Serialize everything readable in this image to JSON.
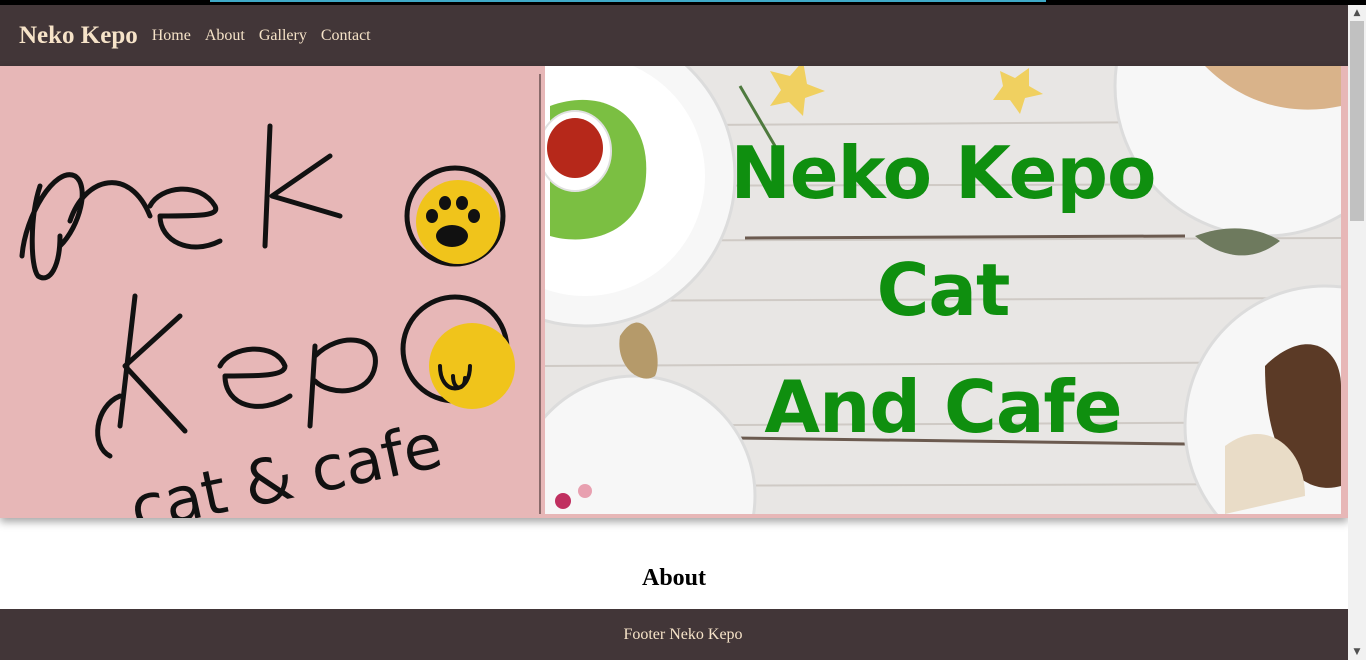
{
  "navbar": {
    "brand": "Neko Kepo",
    "links": [
      "Home",
      "About",
      "Gallery",
      "Contact"
    ]
  },
  "hero": {
    "logo_lines": [
      "neko",
      "kepo",
      "cat & cafe"
    ],
    "banner_lines": [
      "Neko Kepo",
      "Cat",
      "And Cafe"
    ]
  },
  "main": {
    "about_title": "About"
  },
  "footer": {
    "text": "Footer Neko Kepo"
  },
  "colors": {
    "nav_bg": "#423638",
    "nav_text": "#f6e3c8",
    "hero_bg": "#e7b7b7",
    "banner_text": "#0f8f0f",
    "paw_yellow": "#f0c41b"
  },
  "icons": {
    "paw": "paw-icon",
    "scroll_up": "chevron-up-icon",
    "scroll_down": "chevron-down-icon"
  }
}
